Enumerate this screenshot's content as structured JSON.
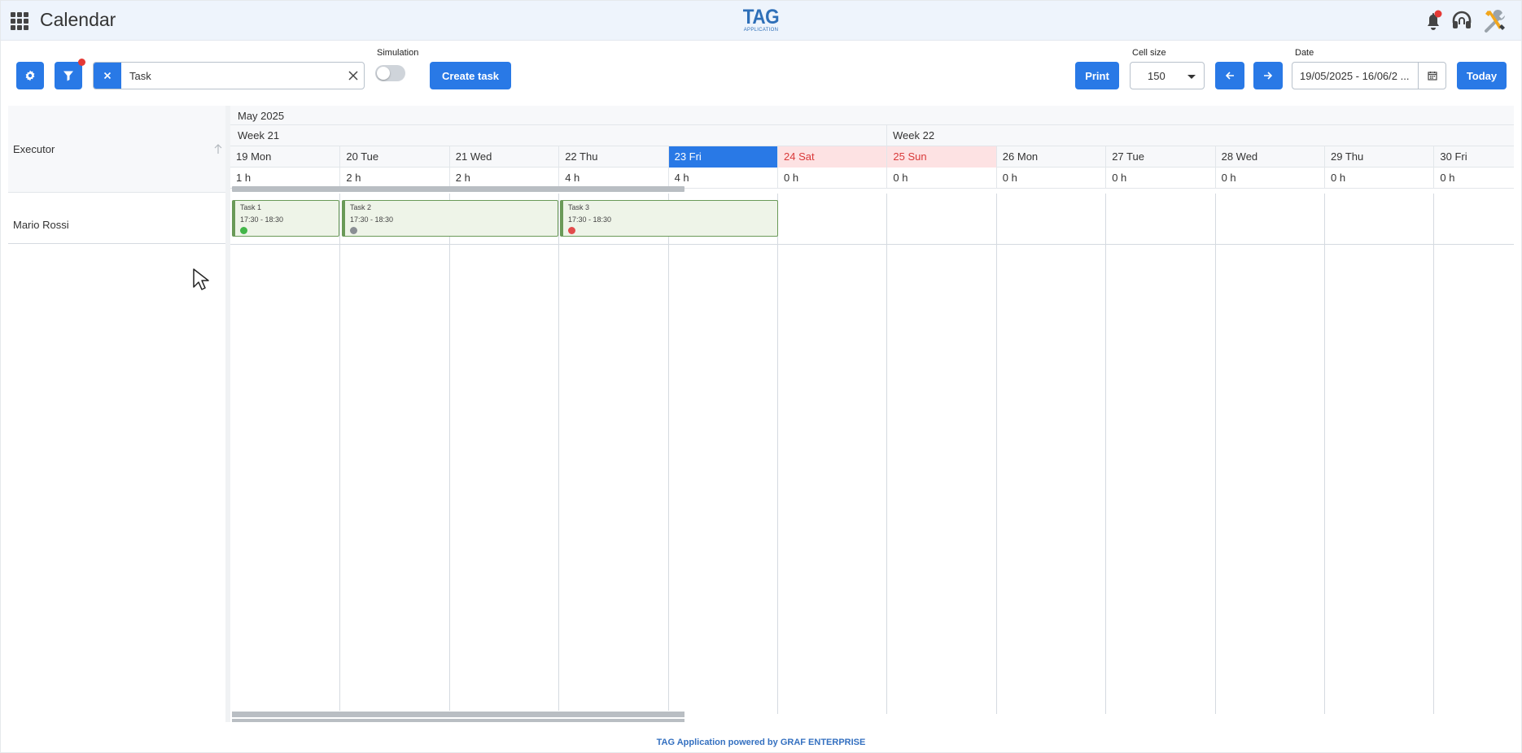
{
  "app": {
    "title": "Calendar"
  },
  "logo": {
    "main": "TAG",
    "sub": "APPLICATION"
  },
  "colors": {
    "primary": "#2979e6",
    "today_header": "#2979e6",
    "weekend_header": "#fde2e3",
    "weekend_text": "#d93a3a",
    "task_border": "#6a9a58",
    "task_fill": "#eef4e8",
    "footer_text": "#3470c0"
  },
  "top_icons": [
    "apps-grid-icon",
    "bell-icon",
    "headset-icon",
    "tools-icon"
  ],
  "toolbar": {
    "search_value": "Task",
    "simulation_label": "Simulation",
    "simulation_on": false,
    "create_task_label": "Create task",
    "print_label": "Print",
    "cell_size_label": "Cell size",
    "cell_size_value": "150",
    "date_label": "Date",
    "date_value": "19/05/2025 - 16/06/2 ...",
    "today_label": "Today"
  },
  "grid": {
    "executor_header": "Executor",
    "month": "May 2025",
    "weeks": [
      {
        "label": "Week 21"
      },
      {
        "label": "Week 22"
      }
    ],
    "days": [
      {
        "label": "19 Mon",
        "hours": "1 h",
        "type": "normal"
      },
      {
        "label": "20 Tue",
        "hours": "2 h",
        "type": "normal"
      },
      {
        "label": "21 Wed",
        "hours": "2 h",
        "type": "normal"
      },
      {
        "label": "22 Thu",
        "hours": "4 h",
        "type": "normal"
      },
      {
        "label": "23 Fri",
        "hours": "4 h",
        "type": "today"
      },
      {
        "label": "24 Sat",
        "hours": "0 h",
        "type": "weekend"
      },
      {
        "label": "25 Sun",
        "hours": "0 h",
        "type": "weekend"
      },
      {
        "label": "26 Mon",
        "hours": "0 h",
        "type": "normal"
      },
      {
        "label": "27 Tue",
        "hours": "0 h",
        "type": "normal"
      },
      {
        "label": "28 Wed",
        "hours": "0 h",
        "type": "normal"
      },
      {
        "label": "29 Thu",
        "hours": "0 h",
        "type": "normal"
      },
      {
        "label": "30 Fri",
        "hours": "0 h",
        "type": "normal"
      }
    ],
    "executors": [
      {
        "name": "Mario Rossi",
        "tasks": [
          {
            "name": "Task 1",
            "time": "17:30 - 18:30",
            "status_color": "#43b649"
          },
          {
            "name": "Task 2",
            "time": "17:30 - 18:30",
            "status_color": "#8a8f94"
          },
          {
            "name": "Task 3",
            "time": "17:30 - 18:30",
            "status_color": "#e24c4c"
          }
        ]
      }
    ]
  },
  "footer": {
    "text": "TAG Application powered by GRAF ENTERPRISE"
  }
}
